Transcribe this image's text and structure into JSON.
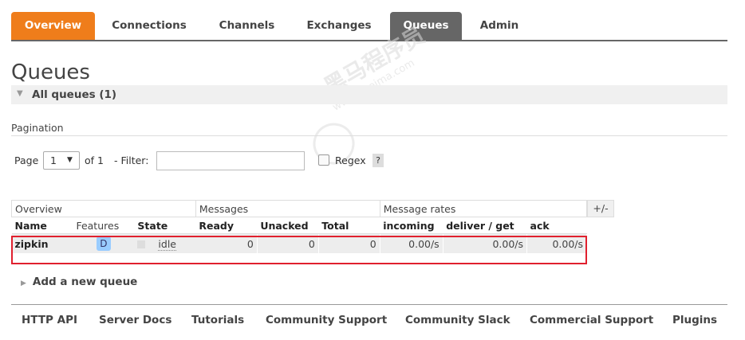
{
  "nav": {
    "tabs": [
      "Overview",
      "Connections",
      "Channels",
      "Exchanges",
      "Queues",
      "Admin"
    ],
    "active": "Queues",
    "accent": "#ef7d1b",
    "active_color": "#666666"
  },
  "watermark": {
    "text": "黑马程序员",
    "sub": "www.itheima.com"
  },
  "page": {
    "title": "Queues"
  },
  "section": {
    "label": "All queues (1)"
  },
  "pagination": {
    "heading": "Pagination",
    "page_label": "Page",
    "page_value": "1",
    "of_label": "of 1",
    "filter_label": "- Filter:",
    "filter_value": "",
    "regex_label": "Regex",
    "help_label": "?"
  },
  "table": {
    "groups": [
      "Overview",
      "Messages",
      "Message rates"
    ],
    "plus_minus": "+/-",
    "columns": [
      "Name",
      "Features",
      "State",
      "Ready",
      "Unacked",
      "Total",
      "incoming",
      "deliver / get",
      "ack"
    ],
    "rows": [
      {
        "name": "zipkin",
        "feature": "D",
        "state": "idle",
        "ready": "0",
        "unacked": "0",
        "total": "0",
        "incoming": "0.00/s",
        "deliver_get": "0.00/s",
        "ack": "0.00/s"
      }
    ],
    "highlight_color": "#e0202e"
  },
  "add_queue": {
    "label": "Add a new queue"
  },
  "footer": {
    "links": [
      "HTTP API",
      "Server Docs",
      "Tutorials",
      "Community Support",
      "Community Slack",
      "Commercial Support",
      "Plugins"
    ]
  }
}
